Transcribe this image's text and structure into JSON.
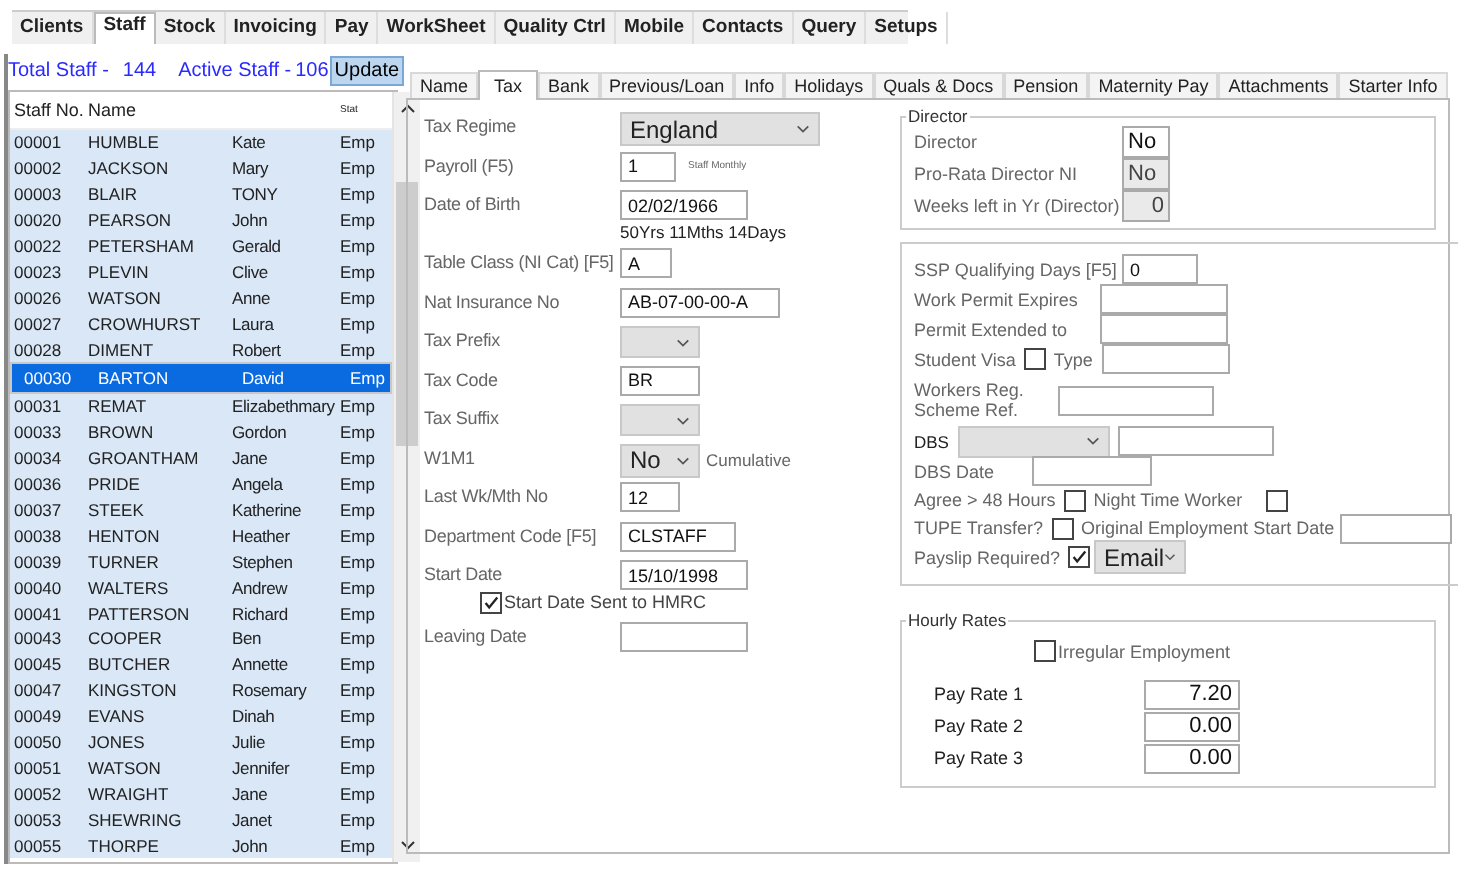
{
  "top_tabs": [
    {
      "label": "Clients",
      "selected": false
    },
    {
      "label": "Staff",
      "selected": true
    },
    {
      "label": "Stock",
      "selected": false
    },
    {
      "label": "Invoicing",
      "selected": false
    },
    {
      "label": "Pay",
      "selected": false
    },
    {
      "label": "WorkSheet",
      "selected": false
    },
    {
      "label": "Quality Ctrl",
      "selected": false
    },
    {
      "label": "Mobile",
      "selected": false
    },
    {
      "label": "Contacts",
      "selected": false
    },
    {
      "label": "Query",
      "selected": false
    },
    {
      "label": "Setups",
      "selected": false
    }
  ],
  "staff_summary": {
    "total_label": "Total Staff -",
    "total_value": "144",
    "active_label": "Active Staff -",
    "active_value": "106",
    "update_button": "Update"
  },
  "staff_table": {
    "columns": [
      "Staff No.",
      "Name",
      "",
      "Stat"
    ],
    "rows": [
      {
        "cells": [
          "00001",
          "HUMBLE",
          "Kate",
          "Emp"
        ],
        "selected": false
      },
      {
        "cells": [
          "00002",
          "JACKSON",
          "Mary",
          "Emp"
        ],
        "selected": false
      },
      {
        "cells": [
          "00003",
          "BLAIR",
          "TONY",
          "Emp"
        ],
        "selected": false
      },
      {
        "cells": [
          "00020",
          "PEARSON",
          "John",
          "Emp"
        ],
        "selected": false
      },
      {
        "cells": [
          "00022",
          "PETERSHAM",
          "Gerald",
          "Emp"
        ],
        "selected": false
      },
      {
        "cells": [
          "00023",
          "PLEVIN",
          "Clive",
          "Emp"
        ],
        "selected": false
      },
      {
        "cells": [
          "00026",
          "WATSON",
          "Anne",
          "Emp"
        ],
        "selected": false
      },
      {
        "cells": [
          "00027",
          "CROWHURST",
          "Laura",
          "Emp"
        ],
        "selected": false
      },
      {
        "cells": [
          "00028",
          "DIMENT",
          "Robert",
          "Emp"
        ],
        "selected": false
      },
      {
        "cells": [
          "00030",
          "BARTON",
          "David",
          "Emp"
        ],
        "selected": true
      },
      {
        "cells": [
          "00031",
          "REMAT",
          "Elizabethmary",
          "Emp"
        ],
        "selected": false
      },
      {
        "cells": [
          "00033",
          "BROWN",
          "Gordon",
          "Emp"
        ],
        "selected": false
      },
      {
        "cells": [
          "00034",
          "GROANTHAM",
          "Jane",
          "Emp"
        ],
        "selected": false
      },
      {
        "cells": [
          "00036",
          "PRIDE",
          "Angela",
          "Emp"
        ],
        "selected": false
      },
      {
        "cells": [
          "00037",
          "STEEK",
          "Katherine",
          "Emp"
        ],
        "selected": false
      },
      {
        "cells": [
          "00038",
          "HENTON",
          "Heather",
          "Emp"
        ],
        "selected": false
      },
      {
        "cells": [
          "00039",
          "TURNER",
          "Stephen",
          "Emp"
        ],
        "selected": false
      },
      {
        "cells": [
          "00040",
          "WALTERS",
          "Andrew",
          "Emp"
        ],
        "selected": false
      },
      {
        "cells": [
          "00041",
          "PATTERSON",
          "Richard",
          "Emp"
        ],
        "selected": false
      },
      {
        "cells": [
          "00043",
          "COOPER",
          "Ben",
          "Emp"
        ],
        "selected": false
      },
      {
        "cells": [
          "00045",
          "BUTCHER",
          "Annette",
          "Emp"
        ],
        "selected": false
      },
      {
        "cells": [
          "00047",
          "KINGSTON",
          "Rosemary",
          "Emp"
        ],
        "selected": false
      },
      {
        "cells": [
          "00049",
          "EVANS",
          "Dinah",
          "Emp"
        ],
        "selected": false
      },
      {
        "cells": [
          "00050",
          "JONES",
          "Julie",
          "Emp"
        ],
        "selected": false
      },
      {
        "cells": [
          "00051",
          "WATSON",
          "Jennifer",
          "Emp"
        ],
        "selected": false
      },
      {
        "cells": [
          "00052",
          "WRAIGHT",
          "Jane",
          "Emp"
        ],
        "selected": false
      },
      {
        "cells": [
          "00053",
          "SHEWRING",
          "Janet",
          "Emp"
        ],
        "selected": false
      },
      {
        "cells": [
          "00055",
          "THORPE",
          "John",
          "Emp"
        ],
        "selected": false
      }
    ]
  },
  "detail_tabs": [
    {
      "label": "Name",
      "selected": false
    },
    {
      "label": "Tax",
      "selected": true
    },
    {
      "label": "Bank",
      "selected": false
    },
    {
      "label": "Previous/Loan",
      "selected": false
    },
    {
      "label": "Info",
      "selected": false
    },
    {
      "label": "Holidays",
      "selected": false
    },
    {
      "label": "Quals & Docs",
      "selected": false
    },
    {
      "label": "Pension",
      "selected": false
    },
    {
      "label": "Maternity Pay",
      "selected": false
    },
    {
      "label": "Attachments",
      "selected": false
    },
    {
      "label": "Starter Info",
      "selected": false
    }
  ],
  "tax_fields": [
    {
      "kind": "select",
      "label": "Tax Regime",
      "value": "England"
    },
    {
      "kind": "input",
      "label": "Payroll (F5)",
      "value": "1",
      "note": "Staff Monthly"
    },
    {
      "kind": "input",
      "label": "Date of Birth",
      "value": "02/02/1966",
      "sub_note": "50Yrs 11Mths 14Days"
    },
    {
      "kind": "input",
      "label": "Table Class (NI Cat) [F5]",
      "value": "A"
    },
    {
      "kind": "input",
      "label": "Nat Insurance No",
      "value": "AB-07-00-00-A"
    },
    {
      "kind": "select",
      "label": "Tax Prefix"
    },
    {
      "kind": "input",
      "label": "Tax Code",
      "value": "BR"
    },
    {
      "kind": "select",
      "label": "Tax Suffix"
    },
    {
      "kind": "select",
      "label": "W1M1",
      "value": "No",
      "note": "Cumulative"
    },
    {
      "kind": "input",
      "label": "Last Wk/Mth No",
      "value": "12"
    },
    {
      "kind": "input",
      "label": "Department Code [F5]",
      "value": "CLSTAFF"
    },
    {
      "kind": "input",
      "label": "Start Date",
      "value": "15/10/1998"
    },
    {
      "kind": "checkbox",
      "label": "Start Date Sent to HMRC",
      "checked": true
    },
    {
      "kind": "input",
      "label": "Leaving Date"
    }
  ],
  "director": {
    "title": "Director",
    "fields": [
      {
        "label": "Director",
        "value": "No",
        "disabled": false
      },
      {
        "label": "Pro-Rata Director NI",
        "value": "No",
        "disabled": true
      },
      {
        "label": "Weeks left in Yr (Director)",
        "value": "0",
        "disabled": true
      }
    ]
  },
  "other": {
    "ssp": {
      "label": "SSP Qualifying Days [F5]",
      "value": "0"
    },
    "work_permit_expires": {
      "label": "Work Permit Expires"
    },
    "permit_extended": {
      "label": "Permit Extended to"
    },
    "student_visa": {
      "label": "Student Visa",
      "checked": false,
      "type_label": "Type"
    },
    "workers_reg": {
      "label": "Workers Reg. Scheme Ref."
    },
    "dbs": {
      "label": "DBS"
    },
    "dbs_date": {
      "label": "DBS Date"
    },
    "agree_48": {
      "label": "Agree > 48 Hours",
      "checked": false
    },
    "night_worker": {
      "label": "Night Time Worker",
      "checked": false
    },
    "tupe": {
      "label": "TUPE Transfer?",
      "checked": false
    },
    "original_start": {
      "label": "Original Employment Start Date"
    },
    "payslip": {
      "label": "Payslip Required?",
      "checked": true,
      "method": "Email"
    }
  },
  "hourly_rates": {
    "title": "Hourly Rates",
    "irregular": {
      "label": "Irregular Employment",
      "checked": false
    },
    "rates": [
      {
        "label": "Pay Rate 1",
        "value": "7.20"
      },
      {
        "label": "Pay Rate 2",
        "value": "0.00"
      },
      {
        "label": "Pay Rate 3",
        "value": "0.00"
      }
    ]
  }
}
